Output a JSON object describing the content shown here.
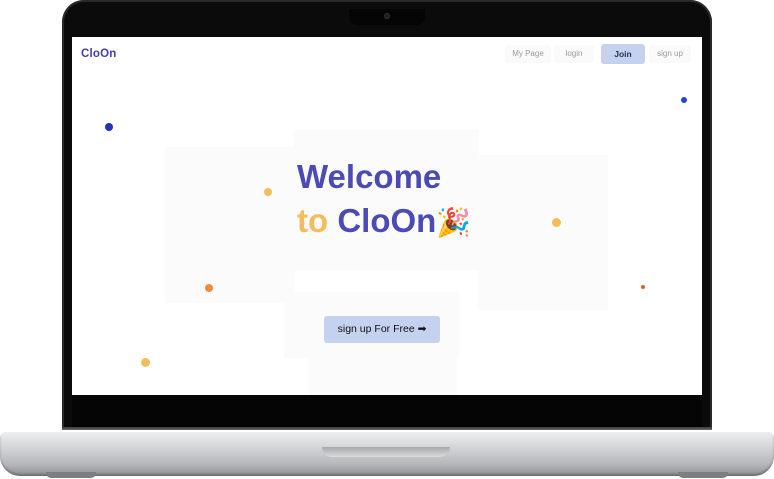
{
  "app": {
    "logo": "CloOn"
  },
  "nav": {
    "items": [
      {
        "label": "My Page"
      },
      {
        "label": "login"
      },
      {
        "label": "Join"
      },
      {
        "label": "sign up"
      }
    ]
  },
  "hero": {
    "line1": "Welcome",
    "line2_prefix": "to",
    "line2_brand": "CloOn",
    "emoji": "🎉",
    "cta_label": "sign up For Free ➡"
  },
  "colors": {
    "brand": "#4b4bb8",
    "accent_yellow": "#f6bb5a",
    "button": "#c4d2ef",
    "dot_orange": "#f08a3a",
    "dot_blue": "#2233bb"
  }
}
